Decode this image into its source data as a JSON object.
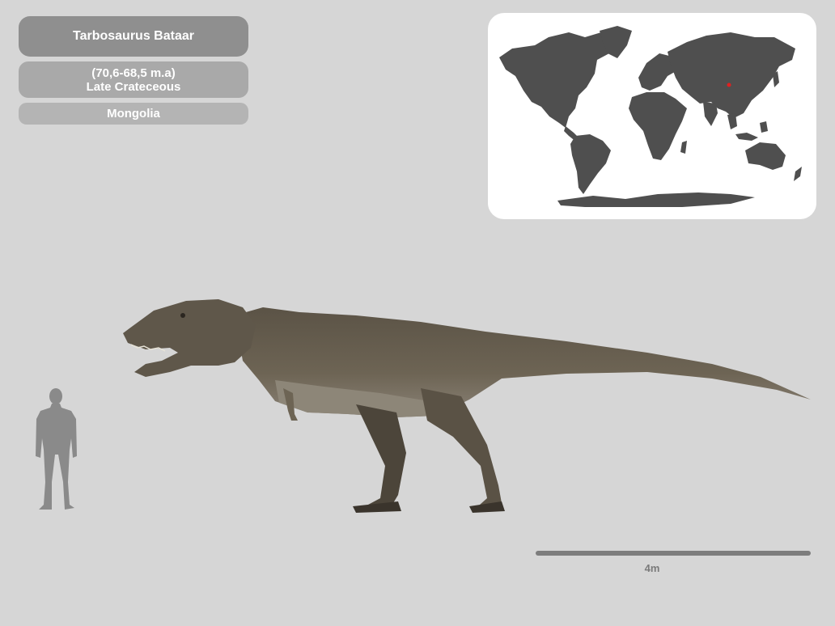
{
  "info": {
    "species": "Tarbosaurus Bataar",
    "age": "(70,6-68,5 m.a)",
    "period": "Late Crateceous",
    "location": "Mongolia"
  },
  "scale": {
    "label": "4m"
  },
  "colors": {
    "background": "#d6d6d6",
    "land": "#4f4f4f",
    "locality_marker": "#e02020",
    "dino_body": "#6b6152"
  }
}
